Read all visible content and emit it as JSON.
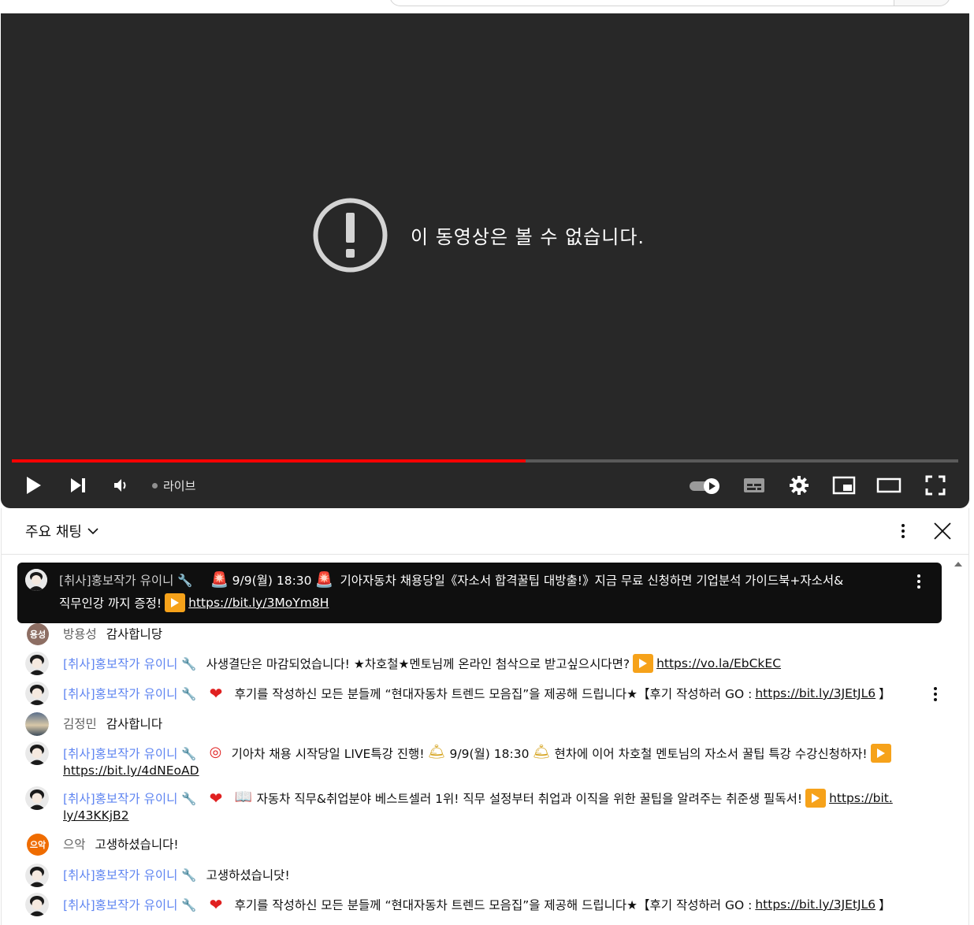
{
  "player": {
    "error_message": "이 동영상은 볼 수 없습니다.",
    "progress_fraction": 0.543,
    "live_label": "라이브"
  },
  "chat": {
    "title": "주요 채팅",
    "pinned": {
      "author": "[취사]홍보작가 유이니",
      "text1a": "9/9(월) 18:30",
      "text1b": "기아자동차 채용당일《자소서 합격꿀팁 대방출!》지금 무료 신청하면 기업분석 가이드북+자소서&",
      "text2": "직무인강 까지 증정!",
      "link": "https://bit.ly/3MoYm8H"
    },
    "messages": [
      {
        "author": "방용성",
        "avatar_text": "용성",
        "text": "감사합니당"
      },
      {
        "author": "[취사]홍보작가 유이니",
        "text": "사생결단은 마감되었습니다! ★차호철★멘토님께 온라인 첨삭으로 받고싶으시다면?",
        "link": "https://vo.la/EbCkEC"
      },
      {
        "author": "[취사]홍보작가 유이니",
        "text": "후기를 작성하신 모든 분들께 “현대자동차 트렌드 모음집”을 제공해 드립니다★【후기 작성하러 GO :",
        "link": "https://bit.ly/3JEtJL6",
        "suffix": "】"
      },
      {
        "author": "김정민",
        "text": "감사합니다"
      },
      {
        "author": "[취사]홍보작가 유이니",
        "text_a": "기아차 채용 시작당일 LIVE특강 진행!",
        "text_b": "9/9(월) 18:30",
        "text_c": "현차에 이어 차호철 멘토님의 자소서 꿀팁 특강 수강신청하자!",
        "link": "https://bit.ly/4dNEoAD"
      },
      {
        "author": "[취사]홍보작가 유이니",
        "text": "자동차 직무&취업분야 베스트셀러 1위! 직무 설정부터 취업과 이직을 위한 꿀팁을 알려주는 취준생 필독서!",
        "link_a": "https://bit.",
        "link_b": "ly/43KKjB2"
      },
      {
        "author": "으악",
        "avatar_text": "으악",
        "text": "고생하셨습니다!"
      },
      {
        "author": "[취사]홍보작가 유이니",
        "text": "고생하셨습니닷!"
      },
      {
        "author": "[취사]홍보작가 유이니",
        "text": "후기를 작성하신 모든 분들께 “현대자동차 트렌드 모음집”을 제공해 드립니다★【후기 작성하러 GO :",
        "link": "https://bit.ly/3JEtJL6",
        "suffix": "】"
      }
    ]
  },
  "colors": {
    "player_bg": "#282828",
    "progress": "#ff0000",
    "moderator_name": "#5e84f1",
    "pinned_bg": "#0f0f0f"
  },
  "icons": [
    "alert-circle-icon",
    "play-icon",
    "next-icon",
    "volume-icon",
    "autoplay-toggle-icon",
    "subtitles-icon",
    "settings-gear-icon",
    "miniplayer-icon",
    "theater-mode-icon",
    "fullscreen-icon",
    "chevron-down-icon",
    "more-vert-icon",
    "close-icon",
    "wrench-icon",
    "siren-emoji",
    "heart-emoji",
    "bell-emoji",
    "target-emoji",
    "book-emoji",
    "play-button-emoji"
  ]
}
